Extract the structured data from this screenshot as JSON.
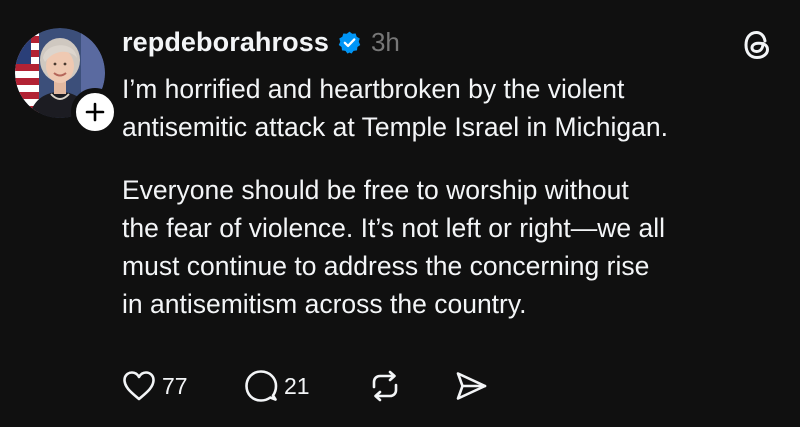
{
  "post": {
    "author": {
      "username": "repdeborahross",
      "verified": true,
      "time": "3h",
      "avatar": "avatar"
    },
    "paragraphs": [
      "I’m horrified and heartbroken by the violent\nantisemitic attack at Temple Israel in Michigan.",
      "Everyone should be free to worship without\nthe fear of violence. It’s not left or right—we all\nmust continue to address the concerning rise\nin antisemitism across the country."
    ],
    "actions": {
      "likes": "77",
      "replies": "21"
    }
  },
  "icons": {
    "verified": "verified-badge-icon",
    "follow": "plus-icon",
    "app": "threads-logo-icon",
    "like": "heart-icon",
    "reply": "speech-bubble-icon",
    "repost": "repost-icon",
    "share": "send-icon"
  },
  "colors": {
    "background": "#101010",
    "text": "#f3f5f7",
    "muted": "#777777",
    "verified": "#0095f6"
  }
}
